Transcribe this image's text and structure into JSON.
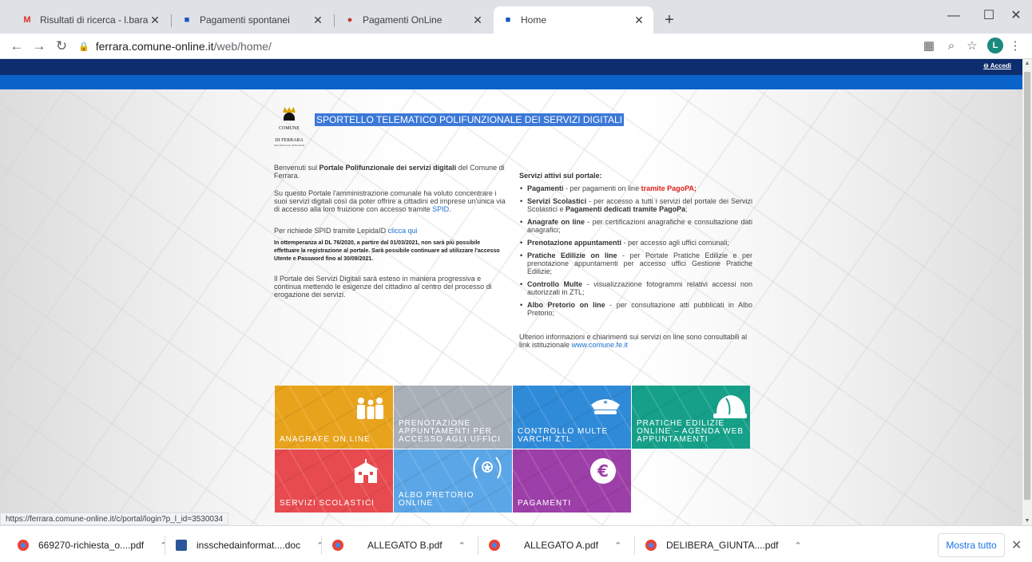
{
  "browser": {
    "tabs": [
      {
        "title": "Risultati di ricerca - l.baraldi@co",
        "favicon": "M"
      },
      {
        "title": "Pagamenti spontanei",
        "favicon": "■"
      },
      {
        "title": "Pagamenti OnLine",
        "favicon": "●"
      },
      {
        "title": "Home",
        "favicon": "■"
      }
    ],
    "address_host": "ferrara.comune-online.it",
    "address_path": "/web/home/",
    "profile_initial": "L"
  },
  "page": {
    "accedi": "Accedi",
    "logo": {
      "line1": "COMUNE",
      "line2": "DI FERRARA",
      "line3": "Città Patrimonio dell'Umanità"
    },
    "title": "SPORTELLO TELEMATICO POLIFUNZIONALE DEI SERVIZI DIGITALI",
    "intro": {
      "p1a": "Benvenuti sul ",
      "p1b": "Portale Polifunzionale dei servizi digitali",
      "p1c": " del Comune di Ferrara.",
      "p2a": "Su questo Portale l'amministrazione comunale ha voluto concentrare i suoi servizi digitali così da poter offrire a cittadini ed imprese un'unica via di accesso alla loro fruizione con accesso tramite ",
      "p2link": "SPID",
      "p2c": ".",
      "p3a": "Per richiede SPID tramite LepidaID ",
      "p3link": "clicca qui",
      "notice": "In ottemperanza al DL 76/2020, a partire dal 01/03/2021, non sarà più possibile effettuare la registrazione al portale. Sarà possibile continuare ad utilizzare l'accesso Utente e Password fino al 30/09/2021.",
      "p4": "Il Portale dei Servizi Digitali sarà esteso in maniera progressiva e continua mettendo le esigenze del cittadino al centro del processo di erogazione dei servizi."
    },
    "services": {
      "header": "Servizi attivi sul portale:",
      "items": [
        {
          "name": "Pagamenti",
          "text": " - per pagamenti on line ",
          "highlight": "tramite PagoPA;"
        },
        {
          "name": "Servizi Scolastici",
          "text": " - per accesso a tutti i servizi del portale dei Servizi Scolastici e ",
          "bold2": "Pagamenti dedicati tramite PagoPa",
          "tail": ";"
        },
        {
          "name": "Anagrafe on line",
          "text": " - per certificazioni anagrafiche e consultazione dati anagrafici;"
        },
        {
          "name": "Prenotazione appuntamenti",
          "text": " - per accesso agli uffici comunali;"
        },
        {
          "name": "Pratiche Edilizie on line",
          "text": " - per Portale Pratiche Edilizie e per prenotazione appuntamenti per accesso uffici Gestione Pratiche Edilizie;"
        },
        {
          "name": "Controllo Multe",
          "text": " - visualizzazione fotogrammi relativi accessi non autorizzati in ZTL;"
        },
        {
          "name": "Albo Pretorio on line",
          "text": " - per consultazione atti pubblicati in Albo Pretorio;"
        }
      ],
      "footer_text": "Ulteriori informazioni e chiarimenti sui servizi on line sono consultabili al link istituzionale ",
      "footer_link": "www.comune.fe.it"
    },
    "tiles": [
      {
        "label": "ANAGRAFE ON LINE",
        "color": "#e8a31c",
        "icon": "family-icon"
      },
      {
        "label": "PRENOTAZIONE APPUNTAMENTI PER ACCESSO AGLI UFFICI",
        "color": "#a9b0b8",
        "icon": "none"
      },
      {
        "label": "CONTROLLO MULTE VARCHI ZTL",
        "color": "#2f8ad8",
        "icon": "police-cap-icon"
      },
      {
        "label": "PRATICHE EDILIZIE ONLINE – AGENDA WEB APPUNTAMENTI",
        "color": "#16a089",
        "icon": "hard-hat-icon"
      },
      {
        "label": "SERVIZI SCOLASTICI",
        "color": "#e74a4f",
        "icon": "school-icon"
      },
      {
        "label": "ALBO PRETORIO ONLINE",
        "color": "#5ba6e6",
        "icon": "laurel-icon"
      },
      {
        "label": "PAGAMENTI",
        "color": "#9d3fa8",
        "icon": "euro-icon"
      }
    ]
  },
  "status_url": "https://ferrara.comune-online.it/c/portal/login?p_l_id=3530034",
  "downloads": [
    {
      "name": "669270-richiesta_o....pdf"
    },
    {
      "name": "insschedainformat....doc"
    },
    {
      "name": "ALLEGATO B.pdf"
    },
    {
      "name": "ALLEGATO A.pdf"
    },
    {
      "name": "DELIBERA_GIUNTA....pdf"
    }
  ],
  "show_all": "Mostra tutto"
}
